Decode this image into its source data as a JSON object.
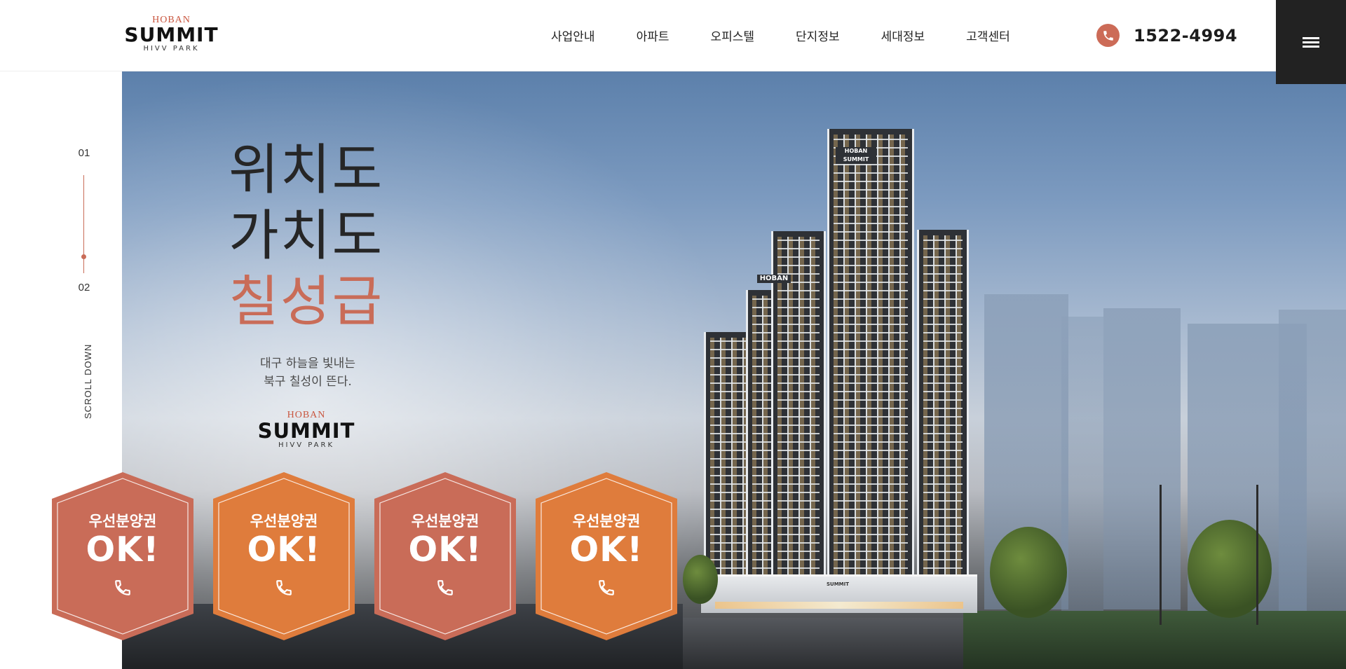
{
  "brand": {
    "top": "HOBAN",
    "name": "SUMMIT",
    "sub": "HIVV PARK",
    "accent": "#c96c58"
  },
  "nav": [
    "사업안내",
    "아파트",
    "오피스텔",
    "단지정보",
    "세대정보",
    "고객센터"
  ],
  "phone": {
    "number": "1522-4994",
    "icon": "phone-icon"
  },
  "menu": {
    "icon": "hamburger-menu-icon"
  },
  "hero": {
    "headline": [
      "위치도",
      "가치도",
      "칠성급"
    ],
    "subtitle": [
      "대구 하늘을 빛내는",
      "북구 칠성이 뜬다."
    ],
    "building_sign_top": "HOBAN SUMMIT",
    "building_sign_mid": "HOBAN",
    "building_sign_podium": "SUMMIT"
  },
  "side": {
    "index_current": "01",
    "index_next": "02",
    "scroll": "SCROLL DOWN"
  },
  "badges": [
    {
      "label": "우선분양권",
      "ok": "OK!",
      "color": "#c96c58",
      "icon": "phone-icon"
    },
    {
      "label": "우선분양권",
      "ok": "OK!",
      "color": "#df7c3c",
      "icon": "phone-icon"
    },
    {
      "label": "우선분양권",
      "ok": "OK!",
      "color": "#c96c58",
      "icon": "phone-icon"
    },
    {
      "label": "우선분양권",
      "ok": "OK!",
      "color": "#df7c3c",
      "icon": "phone-icon"
    }
  ]
}
